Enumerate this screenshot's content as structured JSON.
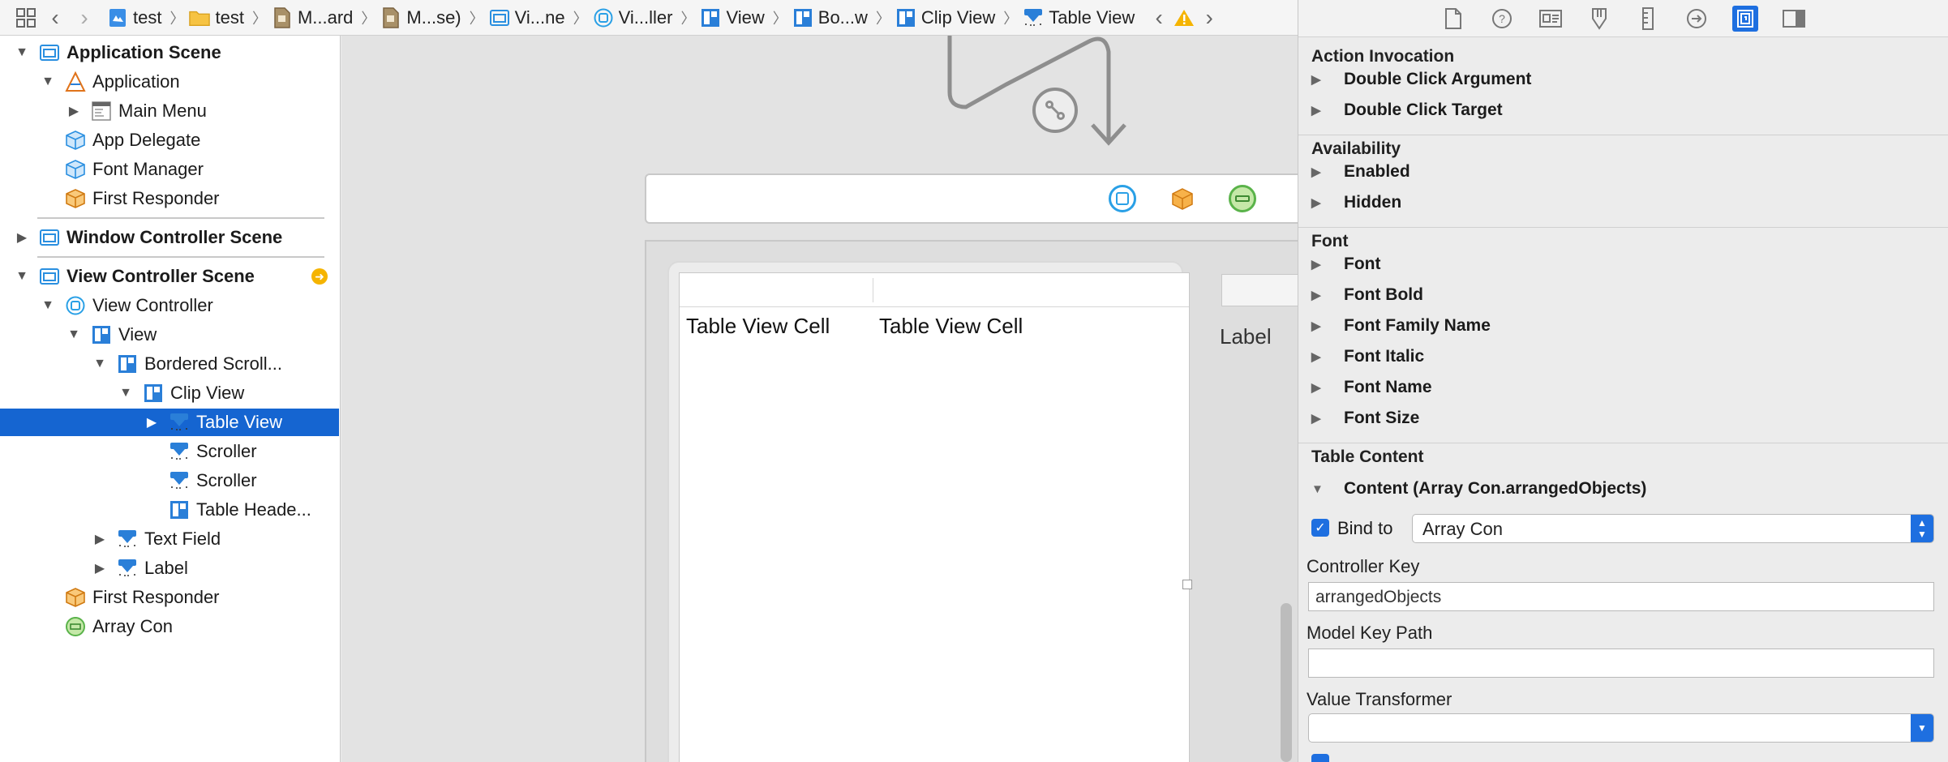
{
  "breadcrumbs": [
    {
      "label": "test",
      "icon": "project-icon"
    },
    {
      "label": "test",
      "icon": "folder-icon"
    },
    {
      "label": "M...ard",
      "icon": "storyboard-icon"
    },
    {
      "label": "M...se)",
      "icon": "storyboard-icon"
    },
    {
      "label": "Vi...ne",
      "icon": "scene-icon"
    },
    {
      "label": "Vi...ller",
      "icon": "view-controller-icon"
    },
    {
      "label": "View",
      "icon": "view-icon"
    },
    {
      "label": "Bo...w",
      "icon": "view-icon"
    },
    {
      "label": "Clip View",
      "icon": "view-icon"
    },
    {
      "label": "Table View",
      "icon": "table-view-icon"
    }
  ],
  "outline": {
    "rows": [
      {
        "label": "Application Scene",
        "level": 0,
        "disc": "open",
        "icon": "scene",
        "bold": true
      },
      {
        "label": "Application",
        "level": 1,
        "disc": "open",
        "icon": "app"
      },
      {
        "label": "Main Menu",
        "level": 2,
        "disc": "closed",
        "icon": "menu"
      },
      {
        "label": "App Delegate",
        "level": 1,
        "disc": "none",
        "icon": "cube-blue"
      },
      {
        "label": "Font Manager",
        "level": 1,
        "disc": "none",
        "icon": "cube-blue"
      },
      {
        "label": "First Responder",
        "level": 1,
        "disc": "none",
        "icon": "cube-orange"
      },
      {
        "label": "Window Controller Scene",
        "level": 0,
        "disc": "closed",
        "icon": "scene",
        "bold": true
      },
      {
        "label": "View Controller Scene",
        "level": 0,
        "disc": "open",
        "icon": "scene",
        "bold": true
      },
      {
        "label": "View Controller",
        "level": 1,
        "disc": "open",
        "icon": "vc"
      },
      {
        "label": "View",
        "level": 2,
        "disc": "open",
        "icon": "view"
      },
      {
        "label": "Bordered Scroll...",
        "level": 3,
        "disc": "open",
        "icon": "view"
      },
      {
        "label": "Clip View",
        "level": 4,
        "disc": "open",
        "icon": "view"
      },
      {
        "label": "Table View",
        "level": 5,
        "disc": "closed",
        "icon": "tableview",
        "selected": true
      },
      {
        "label": "Scroller",
        "level": 5,
        "disc": "none",
        "icon": "tableview"
      },
      {
        "label": "Scroller",
        "level": 5,
        "disc": "none",
        "icon": "tableview"
      },
      {
        "label": "Table Heade...",
        "level": 5,
        "disc": "none",
        "icon": "view"
      },
      {
        "label": "Text Field",
        "level": 3,
        "disc": "closed",
        "icon": "tableview"
      },
      {
        "label": "Label",
        "level": 3,
        "disc": "closed",
        "icon": "tableview"
      },
      {
        "label": "First Responder",
        "level": 1,
        "disc": "none",
        "icon": "cube-orange"
      },
      {
        "label": "Array Con",
        "level": 1,
        "disc": "none",
        "icon": "array"
      }
    ]
  },
  "canvas": {
    "cell1": "Table View Cell",
    "cell2": "Table View Cell",
    "label": "Label"
  },
  "inspector": {
    "sections": [
      {
        "title": "Action Invocation",
        "items": [
          "Double Click Argument",
          "Double Click Target"
        ]
      },
      {
        "title": "Availability",
        "items": [
          "Enabled",
          "Hidden"
        ]
      },
      {
        "title": "Font",
        "items": [
          "Font",
          "Font Bold",
          "Font Family Name",
          "Font Italic",
          "Font Name",
          "Font Size"
        ]
      },
      {
        "title": "Table Content",
        "items": []
      }
    ],
    "content_binding": {
      "title": "Content (Array Con.arrangedObjects)",
      "bind_to_label": "Bind to",
      "bind_to_value": "Array Con",
      "controller_key_label": "Controller Key",
      "controller_key_value": "arrangedObjects",
      "model_key_path_label": "Model Key Path",
      "model_key_path_value": "",
      "value_transformer_label": "Value Transformer",
      "value_transformer_value": ""
    }
  },
  "colors": {
    "accent": "#1e6fe0",
    "selection": "#1565d1",
    "warning": "#f5b400"
  }
}
